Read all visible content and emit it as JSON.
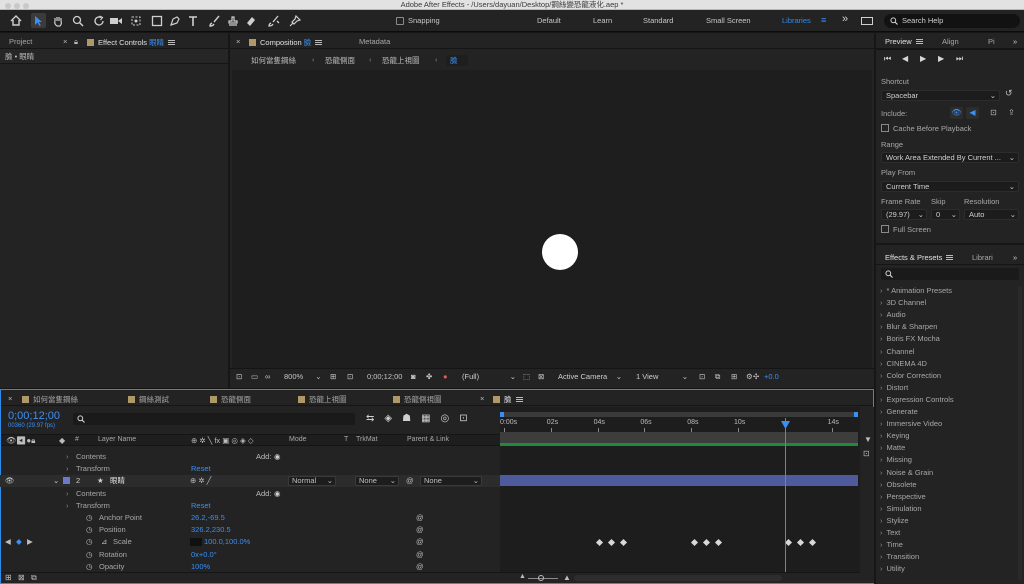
{
  "window": {
    "title": "Adobe After Effects - /Users/dayuan/Desktop/鋼絲變恐龍液化.aep *"
  },
  "toolbar": {
    "snapping_label": "Snapping",
    "workspaces": [
      "Default",
      "Learn",
      "Standard",
      "Small Screen",
      "Libraries"
    ],
    "active_workspace": "Libraries",
    "search_placeholder": "Search Help"
  },
  "left_panel": {
    "tabs": {
      "project": "Project",
      "effect_controls_prefix": "Effect Controls",
      "effect_controls_layer": "眼睛"
    },
    "subtitle": "臉 • 眼睛"
  },
  "comp_panel": {
    "tab_label": "Composition",
    "tab_comp": "臉",
    "metadata_tab": "Metadata",
    "breadcrumbs": [
      "如何當隻鋼絲",
      "恐龍側面",
      "恐龍上視圖",
      "臉"
    ],
    "footer": {
      "zoom": "800%",
      "timecode": "0;00;12;00",
      "resolution": "(Full)",
      "camera": "Active Camera",
      "views": "1 View",
      "exposure": "+0.0"
    }
  },
  "timeline": {
    "tabs": [
      "如何當隻鋼絲",
      "鋼絲測試",
      "恐龍側面",
      "恐龍上視圖",
      "恐龍側視圖",
      "臉"
    ],
    "active_tab": "臉",
    "timecode": "0;00;12;00",
    "frames_info": "00360 (29.97 fps)",
    "search_placeholder": "",
    "columns": {
      "layer_name": "Layer Name",
      "mode": "Mode",
      "t": "T",
      "trkmat": "TrkMat",
      "parent": "Parent & Link"
    },
    "ruler": [
      "0:00s",
      "02s",
      "04s",
      "06s",
      "08s",
      "10s",
      "",
      "14s"
    ],
    "rows": [
      {
        "indent": 1,
        "label": "Contents",
        "extra": "Add:"
      },
      {
        "indent": 1,
        "label": "Transform",
        "value": "Reset"
      },
      {
        "layer": true,
        "num": "2",
        "label": "眼睛",
        "mode": "Normal",
        "trkmat": "None",
        "parent": "None"
      },
      {
        "indent": 1,
        "label": "Contents",
        "extra": "Add:"
      },
      {
        "indent": 1,
        "label": "Transform",
        "value": "Reset"
      },
      {
        "indent": 2,
        "label": "Anchor Point",
        "value": "26.2,-69.5"
      },
      {
        "indent": 2,
        "label": "Position",
        "value": "326.2,230.5"
      },
      {
        "indent": 2,
        "label": "Scale",
        "value": "100.0,100.0%"
      },
      {
        "indent": 2,
        "label": "Rotation",
        "value": "0x+0.0°"
      },
      {
        "indent": 2,
        "label": "Opacity",
        "value": "100%"
      }
    ]
  },
  "preview_panel": {
    "tabs": [
      "Preview",
      "Align",
      "Pi"
    ],
    "shortcut_label": "Shortcut",
    "shortcut_value": "Spacebar",
    "include_label": "Include:",
    "cache_label": "Cache Before Playback",
    "range_label": "Range",
    "range_value": "Work Area Extended By Current ...",
    "play_from_label": "Play From",
    "play_from_value": "Current Time",
    "frame_rate_label": "Frame Rate",
    "skip_label": "Skip",
    "resolution_label": "Resolution",
    "frame_rate_value": "(29.97)",
    "skip_value": "0",
    "resolution_value": "Auto",
    "full_screen_label": "Full Screen"
  },
  "effects_panel": {
    "tabs": [
      "Effects & Presets",
      "Librari"
    ],
    "search_placeholder": "",
    "items": [
      "* Animation Presets",
      "3D Channel",
      "Audio",
      "Blur & Sharpen",
      "Boris FX Mocha",
      "Channel",
      "CINEMA 4D",
      "Color Correction",
      "Distort",
      "Expression Controls",
      "Generate",
      "Immersive Video",
      "Keying",
      "Matte",
      "Missing",
      "Noise & Grain",
      "Obsolete",
      "Perspective",
      "Simulation",
      "Stylize",
      "Text",
      "Time",
      "Transition",
      "Utility"
    ]
  },
  "colors": {
    "accent": "#2d8ceb",
    "layer_label": "#6b79c8",
    "layer_bar": "#4f5a9c",
    "comp_swatch": "#b19869",
    "title_bar": "#e2e2e2"
  }
}
